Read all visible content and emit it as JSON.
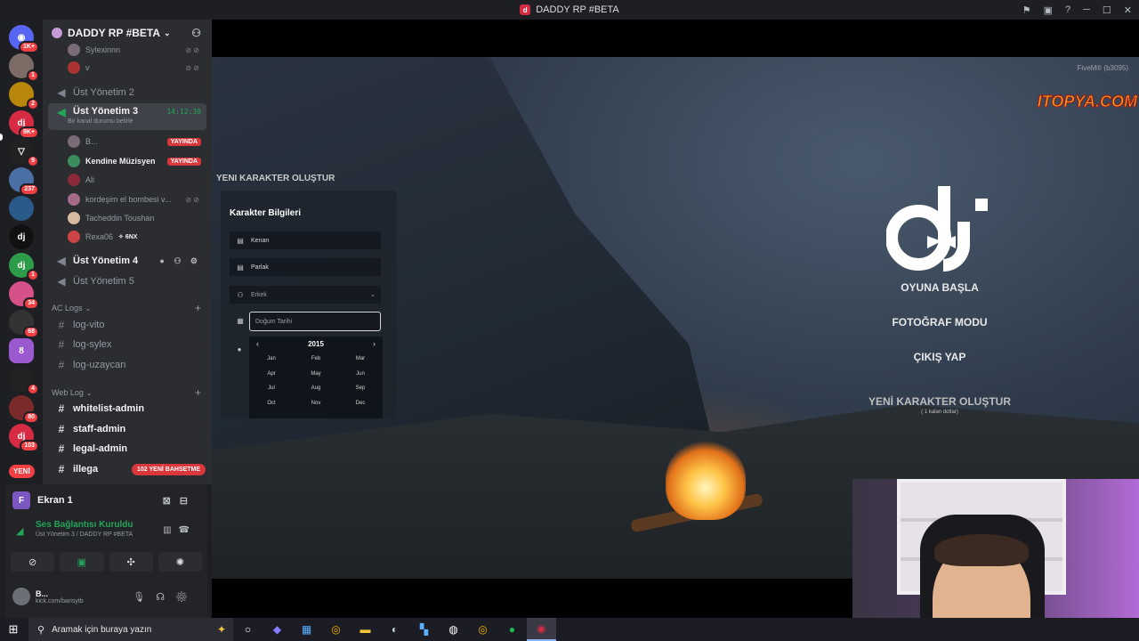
{
  "window": {
    "title": "DADDY RP #BETA"
  },
  "rail": {
    "servers": [
      {
        "badge": "1K+"
      },
      {
        "badge": "1"
      },
      {
        "badge": "2"
      },
      {
        "badge": "9K+"
      },
      {
        "badge": "9"
      },
      {
        "badge": "237"
      },
      {
        "badge": ""
      },
      {
        "badge": ""
      },
      {
        "badge": "1"
      },
      {
        "badge": "34"
      },
      {
        "badge": "68"
      },
      {
        "badge": ""
      },
      {
        "badge": "4"
      },
      {
        "badge": "80"
      },
      {
        "badge": "103"
      }
    ],
    "new_label": "YENİ"
  },
  "server": {
    "name": "DADDY RP #BETA"
  },
  "channels": {
    "top_users": [
      {
        "name": "Sylexinnn"
      },
      {
        "name": "v"
      }
    ],
    "voice": [
      {
        "name": "Üst Yönetim 2"
      },
      {
        "name": "Üst Yönetim 3",
        "status": "Bir kanal durumu belirle",
        "time": "14:12:38"
      },
      {
        "name": "Üst Yönetim 4"
      },
      {
        "name": "Üst Yönetim 5"
      }
    ],
    "voice_users": [
      {
        "name": "B...",
        "live": "YAYINDA"
      },
      {
        "name": "Kendine Müzisyen",
        "live": "YAYINDA"
      },
      {
        "name": "Ali"
      },
      {
        "name": "kordeşim el bombesi v..."
      },
      {
        "name": "Tacheddin Toushan"
      },
      {
        "name": "Rexa06",
        "tag": "✧ 6NX"
      }
    ],
    "categories": [
      {
        "name": "AC Logs",
        "items": [
          "log-vito",
          "log-sylex",
          "log-uzaycan"
        ]
      },
      {
        "name": "Web Log",
        "items": [
          "whitelist-admin",
          "staff-admin",
          "legal-admin",
          "illega"
        ]
      }
    ],
    "new_mentions": "102 YENİ BAHSETME"
  },
  "voice_panel": {
    "screen_label": "Ekran 1",
    "screen_initial": "F",
    "connection": "Ses Bağlantısı Kuruldu",
    "location": "Üst Yönetim 3 / DADDY RP #BETA"
  },
  "user": {
    "name": "B...",
    "status": "kick.com/barisytb"
  },
  "stream": {
    "fivem_label": "FiveM® (b3095)",
    "watermark": "ITOPYA.COM",
    "create_title": "YENI KARAKTER OLUŞTUR",
    "panel_title": "Karakter Bilgileri",
    "fields": {
      "first_name": "Kenan",
      "last_name": "Parlak",
      "gender": "Erkek",
      "dob_placeholder": "Doğum Tarihi"
    },
    "calendar": {
      "year": "2015",
      "months": [
        "Jan",
        "Feb",
        "Mar",
        "Apr",
        "May",
        "Jun",
        "Jul",
        "Aug",
        "Sep",
        "Oct",
        "Nov",
        "Dec"
      ]
    },
    "menu": {
      "start": "OYUNA BAŞLA",
      "photo": "FOTOĞRAF MODU",
      "exit": "ÇIKIŞ YAP",
      "new_char": "YENİ KARAKTER OLUŞTUR",
      "new_char_sub": "( 1 kalan dotlar)"
    }
  },
  "taskbar": {
    "search_placeholder": "Aramak için buraya yazın"
  },
  "colors": {
    "accent_live": "#da373c",
    "voice_green": "#23a559",
    "brand": "#d62b43"
  }
}
